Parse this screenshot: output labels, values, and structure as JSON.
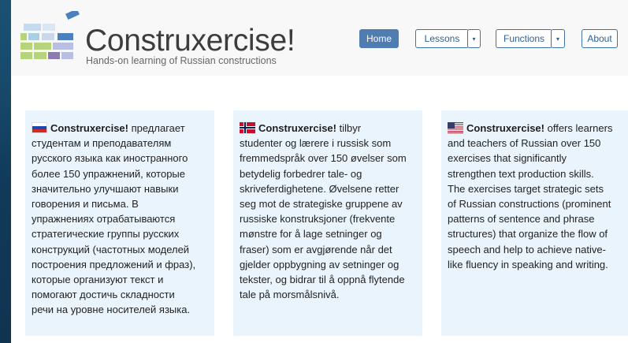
{
  "brand": {
    "name": "Construxercise!",
    "tagline": "Hands-on learning of Russian constructions"
  },
  "nav": {
    "home": "Home",
    "lessons": "Lessons",
    "functions": "Functions",
    "about": "About",
    "dropdown_caret": "▾"
  },
  "cards": {
    "ru": {
      "flag_icon": "russia-flag-icon",
      "title": "Construxercise!",
      "lines": [
        " предлагает",
        "студентам и преподавателям",
        "русского языка как иностранного",
        "более 150 упражнений, которые",
        "значительно улучшают навыки",
        "говорения и письма. В",
        "упражнениях отрабатываются",
        "стратегические группы русских",
        "конструкций (частотных моделей",
        "построения предложений и фраз),",
        "которые организуют текст и",
        "помогают достичь складности",
        "речи на уровне носителей языка."
      ]
    },
    "no": {
      "flag_icon": "norway-flag-icon",
      "title": "Construxercise!",
      "lines": [
        " tilbyr",
        "studenter og lærere i russisk som",
        "fremmedspråk over 150 øvelser som",
        "betydelig forbedrer tale- og",
        "skriveferdighetene. Øvelsene retter",
        "seg mot de strategiske gruppene av",
        "russiske konstruksjoner (frekvente",
        "mønstre for å lage setninger og",
        "fraser) som er avgjørende når det",
        "gjelder oppbygning av setninger og",
        "tekster, og bidrar til å oppnå flytende",
        "tale på morsmålsnivå."
      ]
    },
    "en": {
      "flag_icon": "usa-flag-icon",
      "title": "Construxercise!",
      "lines": [
        " offers learners",
        "and teachers of Russian over 150",
        "exercises that significantly",
        "strengthen text production skills.",
        "The exercises target strategic sets",
        "of Russian constructions (prominent",
        "patterns of sentence and phrase",
        "structures) that organize the flow of",
        "speech and help to achieve native-",
        "like fluency in speaking and writing."
      ]
    }
  },
  "colors": {
    "primary_button": "#4f7db1",
    "card_background": "#eaf4fc",
    "page_background": "#123d5c",
    "logo_blue": "#4b7fbd",
    "logo_green": "#b6d57a",
    "logo_purple": "#8a7ab0"
  }
}
